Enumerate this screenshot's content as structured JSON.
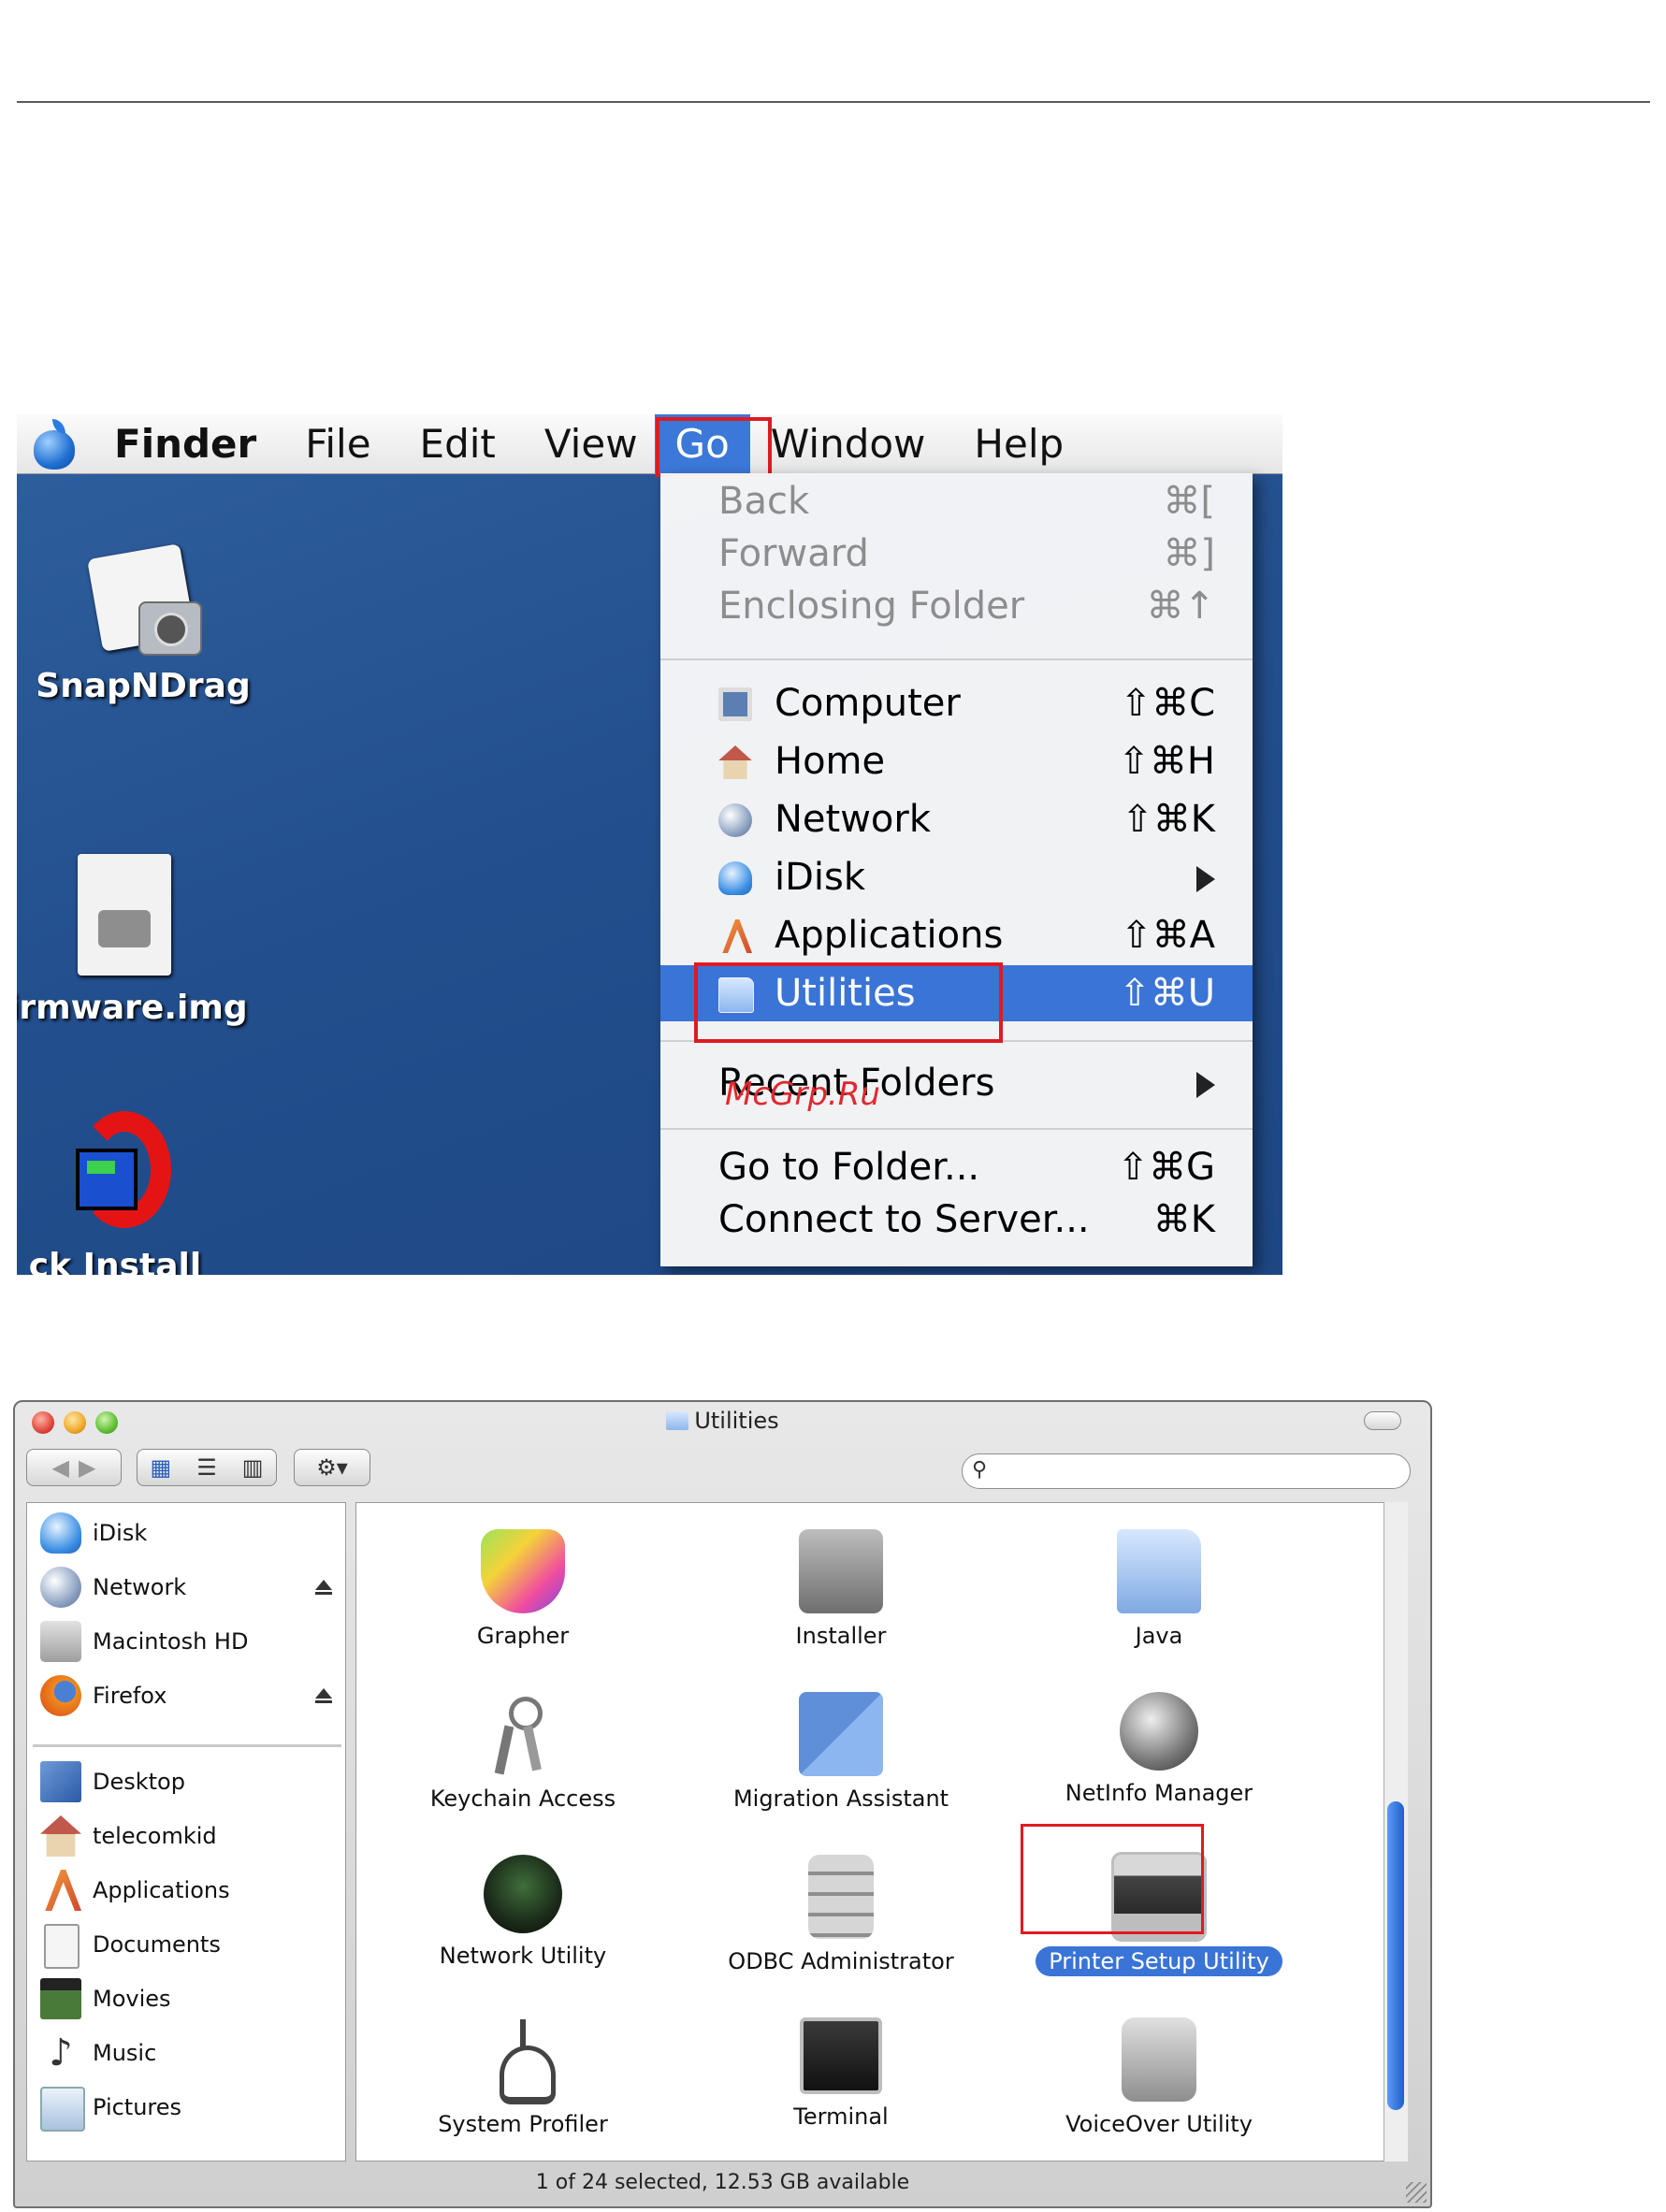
{
  "menubar": {
    "items": [
      "Finder",
      "File",
      "Edit",
      "View",
      "Go",
      "Window",
      "Help"
    ]
  },
  "desktop": {
    "icons": [
      "SnapNDrag",
      "irmware.img",
      "ck Install Wizard"
    ]
  },
  "go_menu": {
    "items": [
      {
        "label": "Back",
        "shortcut": "⌘[",
        "enabled": false,
        "icon": "none"
      },
      {
        "label": "Forward",
        "shortcut": "⌘]",
        "enabled": false,
        "icon": "none"
      },
      {
        "label": "Enclosing Folder",
        "shortcut": "⌘↑",
        "enabled": false,
        "icon": "none"
      },
      {
        "label": "Computer",
        "shortcut": "⇧⌘C",
        "enabled": true,
        "icon": "computer-icon"
      },
      {
        "label": "Home",
        "shortcut": "⇧⌘H",
        "enabled": true,
        "icon": "home-icon"
      },
      {
        "label": "Network",
        "shortcut": "⇧⌘K",
        "enabled": true,
        "icon": "network-globe-icon"
      },
      {
        "label": "iDisk",
        "shortcut": "",
        "enabled": true,
        "icon": "idisk-icon",
        "submenu": true
      },
      {
        "label": "Applications",
        "shortcut": "⇧⌘A",
        "enabled": true,
        "icon": "applications-icon"
      },
      {
        "label": "Utilities",
        "shortcut": "⇧⌘U",
        "enabled": true,
        "icon": "utilities-folder-icon",
        "selected": true
      },
      {
        "label": "Recent Folders",
        "shortcut": "",
        "enabled": true,
        "icon": "none",
        "submenu": true
      },
      {
        "label": "Go to Folder...",
        "shortcut": "⇧⌘G",
        "enabled": true,
        "icon": "none"
      },
      {
        "label": "Connect to Server...",
        "shortcut": "⌘K",
        "enabled": true,
        "icon": "none"
      }
    ]
  },
  "watermark": "McGrp.Ru",
  "utilities_window": {
    "title": "Utilities",
    "sidebar": {
      "devices": [
        "iDisk",
        "Network",
        "Macintosh HD",
        "Firefox"
      ],
      "places": [
        "Desktop",
        "telecomkid",
        "Applications",
        "Documents",
        "Movies",
        "Music",
        "Pictures"
      ]
    },
    "items": [
      "Grapher",
      "Installer",
      "Java",
      "Keychain Access",
      "Migration Assistant",
      "NetInfo Manager",
      "Network Utility",
      "ODBC Administrator",
      "Printer Setup Utility",
      "System Profiler",
      "Terminal",
      "VoiceOver Utility"
    ],
    "selected_item": "Printer Setup Utility",
    "status": "1 of 24 selected, 12.53 GB available"
  },
  "colors": {
    "highlight": "#3a74d6",
    "callout_red": "#e01a22",
    "desktop_blue": "#234f8e"
  }
}
